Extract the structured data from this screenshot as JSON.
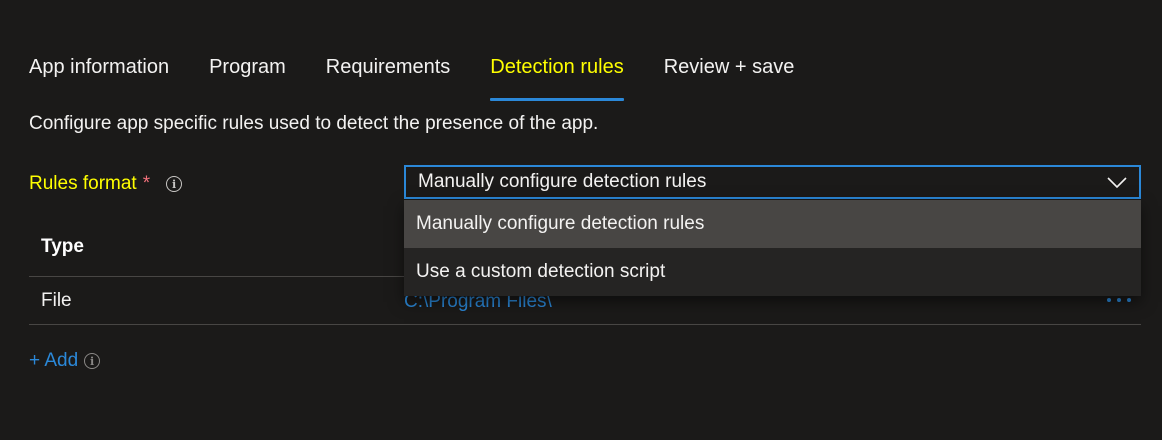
{
  "tabs": [
    {
      "label": "App information"
    },
    {
      "label": "Program"
    },
    {
      "label": "Requirements"
    },
    {
      "label": "Detection rules",
      "active": true
    },
    {
      "label": "Review + save"
    }
  ],
  "description": "Configure app specific rules used to detect the presence of the app.",
  "rules_format": {
    "label": "Rules format",
    "required_marker": "*",
    "info_icon": "info-icon",
    "selected_value": "Manually configure detection rules",
    "options": [
      "Manually configure detection rules",
      "Use a custom detection script"
    ]
  },
  "table": {
    "header_type": "Type",
    "rows": [
      {
        "type": "File",
        "path": "C:\\Program Files\\"
      }
    ]
  },
  "add_link": {
    "label": "+ Add"
  },
  "colors": {
    "background": "#1b1a19",
    "accent": "#2b88d8",
    "highlight": "#ffff00",
    "required": "#f1707b",
    "dropdown_bg": "#252423",
    "selected_option_bg": "#484644"
  }
}
